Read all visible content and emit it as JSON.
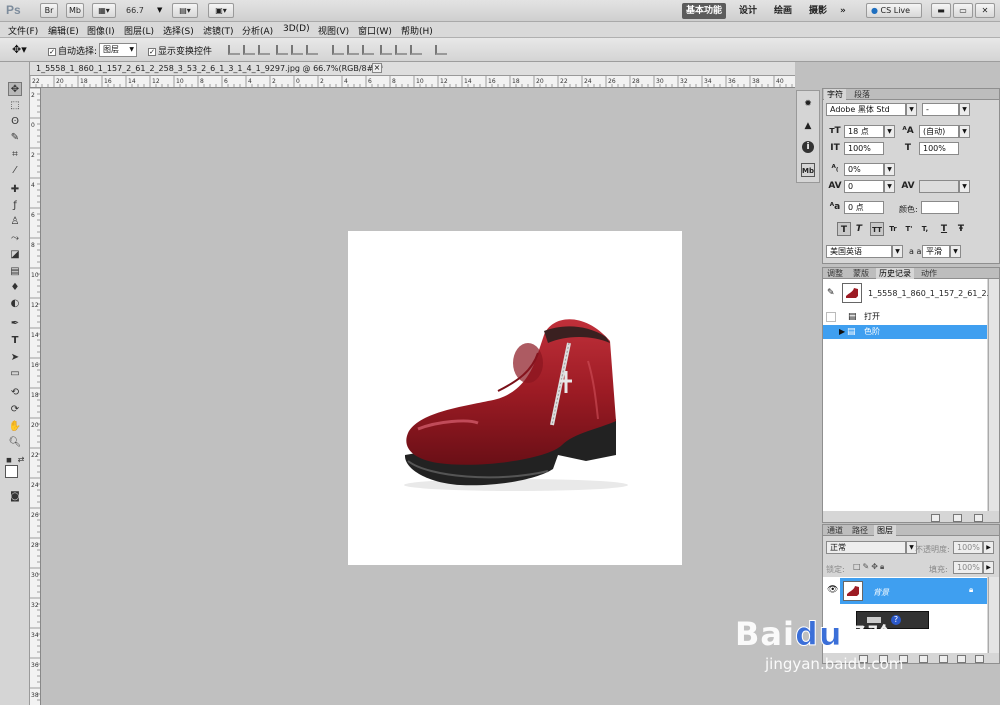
{
  "app": {
    "logo": "Ps",
    "zoom": "66.7",
    "br_label": "Br",
    "mb_label": "Mb"
  },
  "workspaces": [
    "基本功能",
    "设计",
    "绘画",
    "摄影",
    "»"
  ],
  "cslive": "CS Live",
  "menu": [
    "文件(F)",
    "编辑(E)",
    "图像(I)",
    "图层(L)",
    "选择(S)",
    "滤镜(T)",
    "分析(A)",
    "3D(D)",
    "视图(V)",
    "窗口(W)",
    "帮助(H)"
  ],
  "options": {
    "auto_select_label": "自动选择:",
    "auto_select_value": "图层",
    "show_transform_label": "显示变换控件"
  },
  "document": {
    "tab_title": "1_5558_1_860_1_157_2_61_2_258_3_53_2_6_1_3_1_4_1_9297.jpg @ 66.7%(RGB/8#) *",
    "close": "×"
  },
  "ruler_h": [
    "22",
    "20",
    "18",
    "16",
    "14",
    "12",
    "10",
    "8",
    "6",
    "4",
    "2",
    "0",
    "2",
    "4",
    "6",
    "8",
    "10",
    "12",
    "14",
    "16",
    "18",
    "20",
    "22",
    "24",
    "26",
    "28",
    "30",
    "32",
    "34",
    "36",
    "38",
    "40"
  ],
  "ruler_v": [
    "2",
    "0",
    "2",
    "4",
    "6",
    "8",
    "10",
    "12",
    "14",
    "16",
    "18",
    "20",
    "22",
    "24",
    "26",
    "28",
    "30",
    "32",
    "34",
    "36",
    "38"
  ],
  "char_panel": {
    "tabs": [
      "字符",
      "段落"
    ],
    "font_family": "Adobe 黑体 Std",
    "font_style": "-",
    "font_size": "18 点",
    "leading": "(自动)",
    "vscale": "100%",
    "hscale": "100%",
    "baseline_pct": "0%",
    "tracking": "0",
    "baseline_shift": "0 点",
    "color_label": "颜色:",
    "language": "美国英语",
    "aa_label": "a a",
    "antialias": "平滑",
    "style_buttons": [
      "T",
      "T",
      "TT",
      "Tr",
      "T'",
      "T,",
      "T",
      "Ŧ"
    ]
  },
  "history_panel": {
    "tabs": [
      "调整",
      "蒙版",
      "历史记录",
      "动作"
    ],
    "snapshot": "1_5558_1_860_1_157_2_61_2...",
    "items": [
      {
        "label": "打开",
        "selected": false
      },
      {
        "label": "色阶",
        "selected": true
      }
    ]
  },
  "layers_panel": {
    "tabs": [
      "通道",
      "路径",
      "图层"
    ],
    "blend_mode": "正常",
    "opacity_label": "不透明度:",
    "opacity": "100%",
    "lock_label": "锁定:",
    "fill_label": "填充:",
    "fill": "100%",
    "layer_name": "背景"
  },
  "watermark": {
    "main": "Bai",
    "paw": "du",
    "cn": "经验",
    "url": "jingyan.baidu.com"
  },
  "colors": {
    "selection": "#3f9ff0",
    "shoe": "#9c1b24"
  }
}
